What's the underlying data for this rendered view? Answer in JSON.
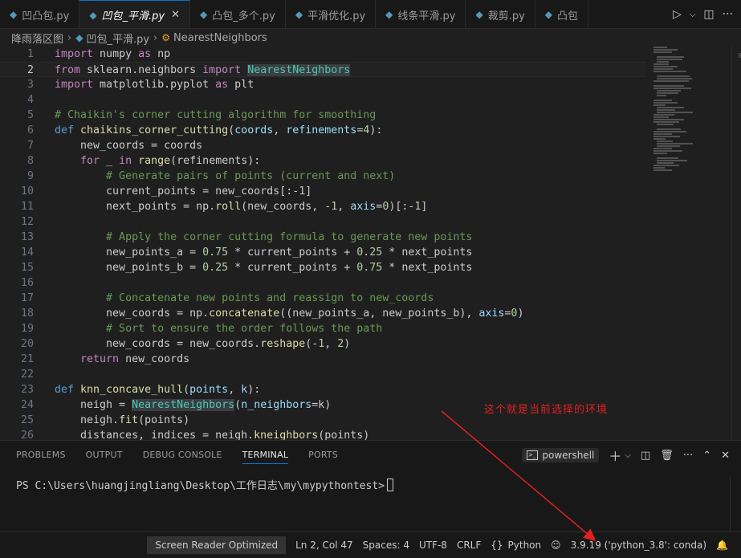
{
  "tabs": [
    {
      "label": "凹凸包.py",
      "active": false,
      "closable": false
    },
    {
      "label": "凹包_平滑.py",
      "active": true,
      "closable": true
    },
    {
      "label": "凸包_多个.py",
      "active": false,
      "closable": false
    },
    {
      "label": "平滑优化.py",
      "active": false,
      "closable": false
    },
    {
      "label": "线条平滑.py",
      "active": false,
      "closable": false
    },
    {
      "label": "裁剪.py",
      "active": false,
      "closable": false
    },
    {
      "label": "凸包",
      "active": false,
      "closable": false
    }
  ],
  "breadcrumb": {
    "folder": "降雨落区图",
    "file": "凹包_平滑.py",
    "symbol": "NearestNeighbors"
  },
  "editor": {
    "current_line": 2,
    "line_numbers": [
      "1",
      "2",
      "3",
      "4",
      "5",
      "6",
      "7",
      "8",
      "9",
      "10",
      "11",
      "12",
      "13",
      "14",
      "15",
      "16",
      "17",
      "18",
      "19",
      "20",
      "21",
      "22",
      "23",
      "24",
      "25",
      "26"
    ]
  },
  "panel": {
    "tabs": [
      "PROBLEMS",
      "OUTPUT",
      "DEBUG CONSOLE",
      "TERMINAL",
      "PORTS"
    ],
    "active_tab": "TERMINAL",
    "shell_label": "powershell",
    "prompt": "PS C:\\Users\\huangjingliang\\Desktop\\工作日志\\my\\mypythontest>"
  },
  "status": {
    "screen_reader": "Screen Reader Optimized",
    "position": "Ln 2, Col 47",
    "spaces": "Spaces: 4",
    "encoding": "UTF-8",
    "eol": "CRLF",
    "language": "Python",
    "interpreter": "3.9.19 ('python_3.8': conda)"
  },
  "annotation": {
    "text": "这个就是当前选择的环境",
    "color": "#e02020"
  },
  "icons": {
    "python_file": "python-file-icon",
    "class_symbol": "class-symbol-icon",
    "run": "run-icon",
    "split_editor": "split-editor-icon",
    "more": "more-icon"
  }
}
